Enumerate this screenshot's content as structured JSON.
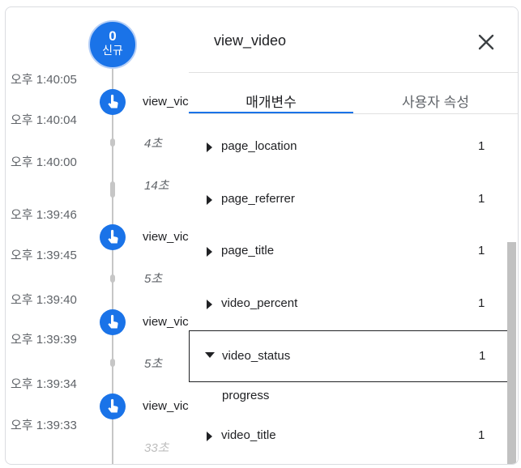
{
  "timeline": {
    "badge_count": "0",
    "badge_label": "신규",
    "times": [
      "오후 1:40:05",
      "오후 1:40:04",
      "오후 1:40:00",
      "오후 1:39:46",
      "오후 1:39:45",
      "오후 1:39:40",
      "오후 1:39:39",
      "오후 1:39:34",
      "오후 1:39:33"
    ],
    "events": [
      "view_vic",
      "view_vic",
      "view_vic",
      "view_vic"
    ],
    "durations": [
      "4초",
      "14초",
      "5초",
      "5초",
      "33초"
    ]
  },
  "panel": {
    "title": "view_video",
    "tabs": [
      "매개변수",
      "사용자 속성"
    ],
    "params": [
      {
        "name": "page_location",
        "count": "1"
      },
      {
        "name": "page_referrer",
        "count": "1"
      },
      {
        "name": "page_title",
        "count": "1"
      },
      {
        "name": "video_percent",
        "count": "1"
      },
      {
        "name": "video_status",
        "count": "1"
      },
      {
        "name": "video_title",
        "count": "1"
      }
    ],
    "expanded_value": "progress"
  },
  "colors": {
    "accent": "#1a73e8",
    "line": "#c6c6c6",
    "text": "#202124",
    "muted": "#5f6368"
  }
}
